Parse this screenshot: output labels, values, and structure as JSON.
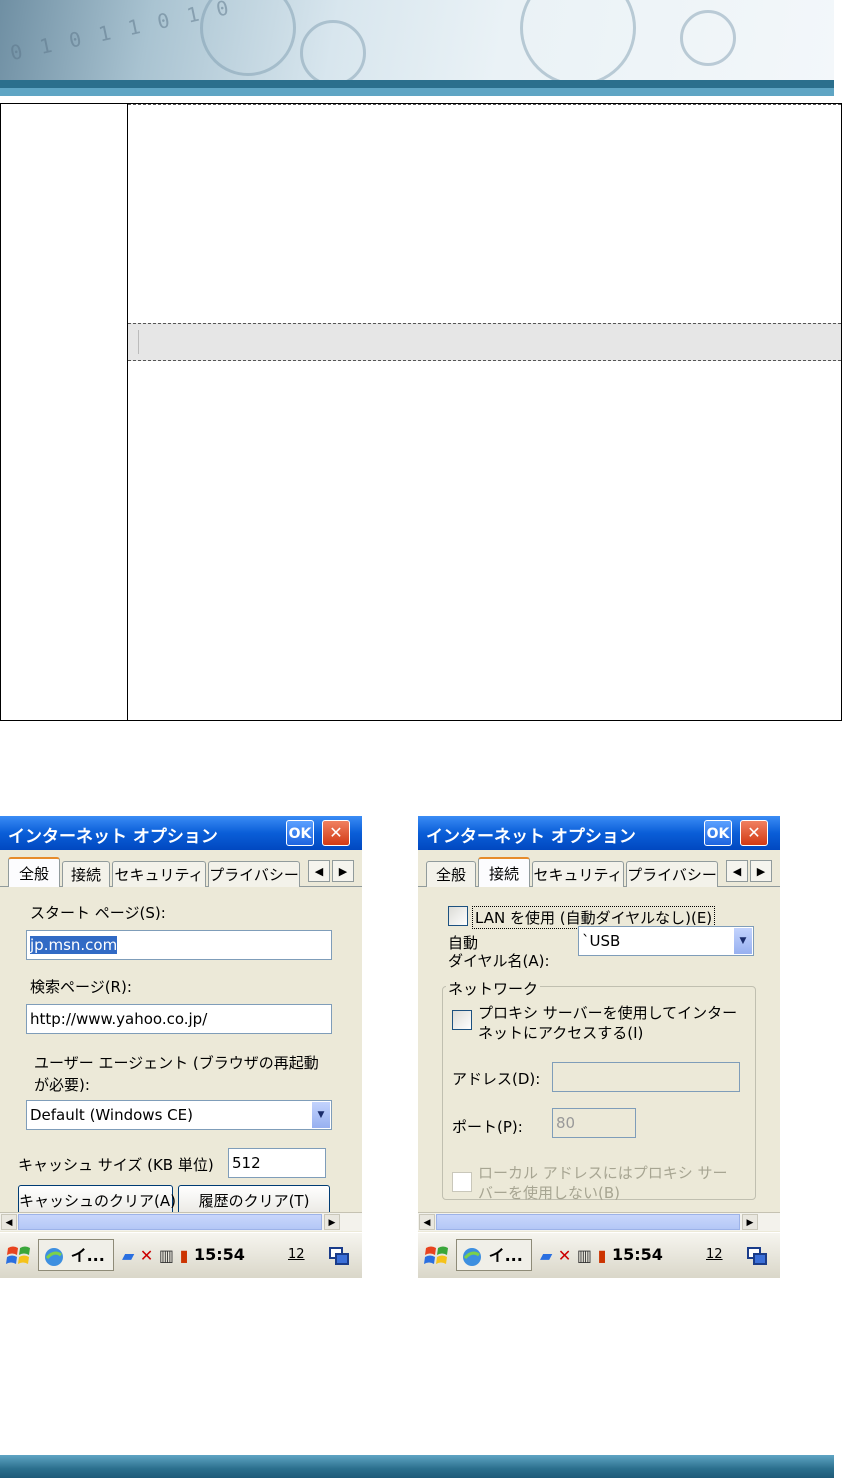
{
  "window_common": {
    "title": "インターネット オプション",
    "ok_label": "OK",
    "close_label": "✕"
  },
  "tabs": [
    "全般",
    "接続",
    "セキュリティ",
    "プライバシー"
  ],
  "general": {
    "start_page_label": "スタート ページ(S):",
    "start_page_value": "jp.msn.com",
    "search_page_label": "検索ページ(R):",
    "search_page_value": "http://www.yahoo.co.jp/",
    "user_agent_label_1": "ユーザー エージェント (ブラウザの再起動",
    "user_agent_label_2": "が必要):",
    "user_agent_value": "Default (Windows CE)",
    "cache_size_label": "キャッシュ サイズ (KB 単位)",
    "cache_size_value": "512",
    "clear_cache_button": "キャッシュのクリア(A)",
    "clear_history_button": "履歴のクリア(T)"
  },
  "connection": {
    "use_lan_label": "LAN を使用 (自動ダイヤルなし)(E)",
    "autodial_label_1": "自動",
    "autodial_label_2": "ダイヤル名(A):",
    "autodial_value": "`USB",
    "network_group_label": "ネットワーク",
    "proxy_label_1": "プロキシ サーバーを使用してインター",
    "proxy_label_2": "ネットにアクセスする(I)",
    "address_label": "アドレス(D):",
    "address_value": "",
    "port_label": "ポート(P):",
    "port_value": "80",
    "bypass_label_1": "ローカル アドレスにはプロキシ サー",
    "bypass_label_2": "バーを使用しない(B)"
  },
  "taskbar": {
    "task_label": "イ...",
    "time": "15:54",
    "input_mode": "12"
  },
  "icons": {
    "start": "windows-flag-icon",
    "ie": "ie-globe-icon",
    "network": "network-icon",
    "antenna": "antenna-off-icon",
    "signal": "signal-icon",
    "battery": "battery-icon",
    "desktop": "show-desktop-icon"
  },
  "colors": {
    "titlebar": "#0a5ed8",
    "dialog_bg": "#ece9d8",
    "selection": "#316ac5",
    "accent_tab": "#e68b2c",
    "banner_strip": "#2b6f8d"
  }
}
